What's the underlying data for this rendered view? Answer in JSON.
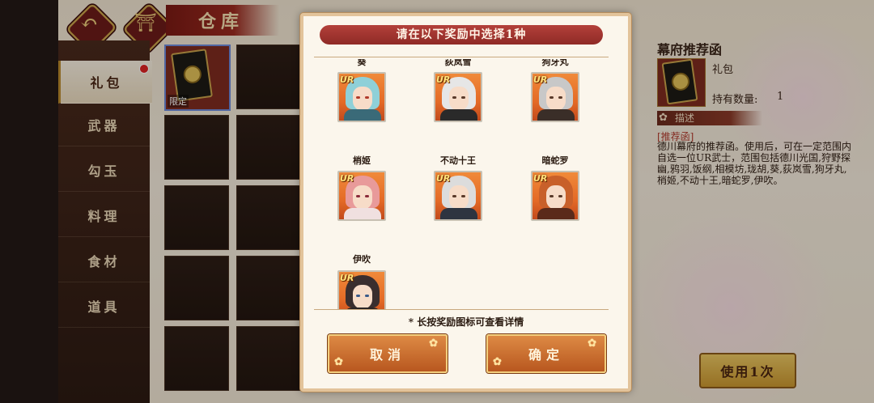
{
  "header": {
    "title": "仓库",
    "back_icon": "back-arrow-icon",
    "home_icon": "shrine-home-icon"
  },
  "sidebar": {
    "items": [
      {
        "label": "礼包",
        "active": true,
        "badge": true
      },
      {
        "label": "武器",
        "active": false
      },
      {
        "label": "勾玉",
        "active": false
      },
      {
        "label": "料理",
        "active": false
      },
      {
        "label": "食材",
        "active": false
      },
      {
        "label": "道具",
        "active": false
      }
    ]
  },
  "inventory": {
    "first_item_tag": "限定"
  },
  "detail": {
    "title": "幕府推荐函",
    "type": "礼包",
    "count_label": "持有数量:",
    "count": "1",
    "desc_header": "描述",
    "desc_tag": "[推荐函]",
    "desc_body": "德川幕府的推荐函。使用后，可在一定范围内自选一位UR武士，范围包括德川光国,狩野探幽,鸦羽,饭纲,相模坊,珑胡,葵,荻岚雪,狗牙丸,梢姬,不动十王,暗蛇罗,伊吹。",
    "use_button": "使用1次"
  },
  "dialog": {
    "title": "请在以下奖励中选择1种",
    "rewards": [
      {
        "name": "葵",
        "rarity": "UR"
      },
      {
        "name": "荻岚雪",
        "rarity": "UR"
      },
      {
        "name": "狗牙丸",
        "rarity": "UR"
      },
      {
        "name": "梢姬",
        "rarity": "UR"
      },
      {
        "name": "不动十王",
        "rarity": "UR"
      },
      {
        "name": "暗蛇罗",
        "rarity": "UR"
      },
      {
        "name": "伊吹",
        "rarity": "UR"
      }
    ],
    "hint": "* 长按奖励图标可查看详情",
    "cancel_label": "取消",
    "confirm_label": "确定"
  },
  "colors": {
    "accent_red": "#8f2a26",
    "gold": "#c9a24a",
    "button_orange": "#dd8a44"
  }
}
